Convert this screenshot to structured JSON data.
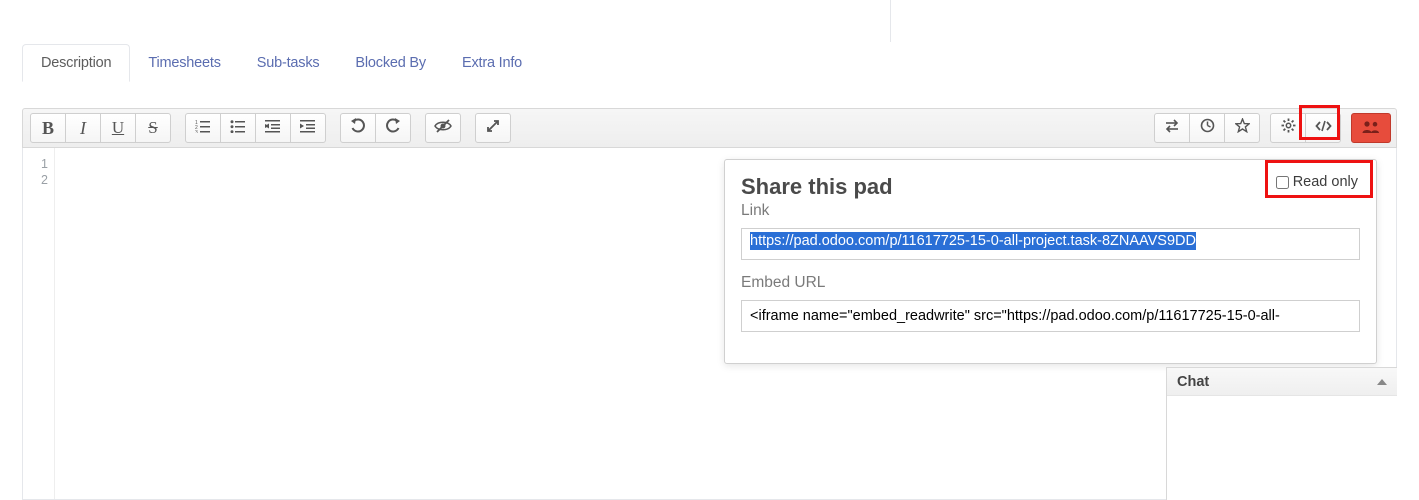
{
  "tabs": {
    "description": "Description",
    "timesheets": "Timesheets",
    "subtasks": "Sub-tasks",
    "blockedby": "Blocked By",
    "extrainfo": "Extra Info"
  },
  "toolbar": {
    "bold": "B",
    "italic": "I",
    "underline": "U",
    "strike": "S"
  },
  "editor": {
    "line1": "1",
    "line2": "2"
  },
  "share": {
    "title": "Share this pad",
    "readonly_label": "Read only",
    "link_label": "Link",
    "link_value": "https://pad.odoo.com/p/11617725-15-0-all-project.task-8ZNAAVS9DD",
    "embed_label": "Embed URL",
    "embed_value": "<iframe name=\"embed_readwrite\" src=\"https://pad.odoo.com/p/11617725-15-0-all-"
  },
  "chat": {
    "title": "Chat"
  }
}
